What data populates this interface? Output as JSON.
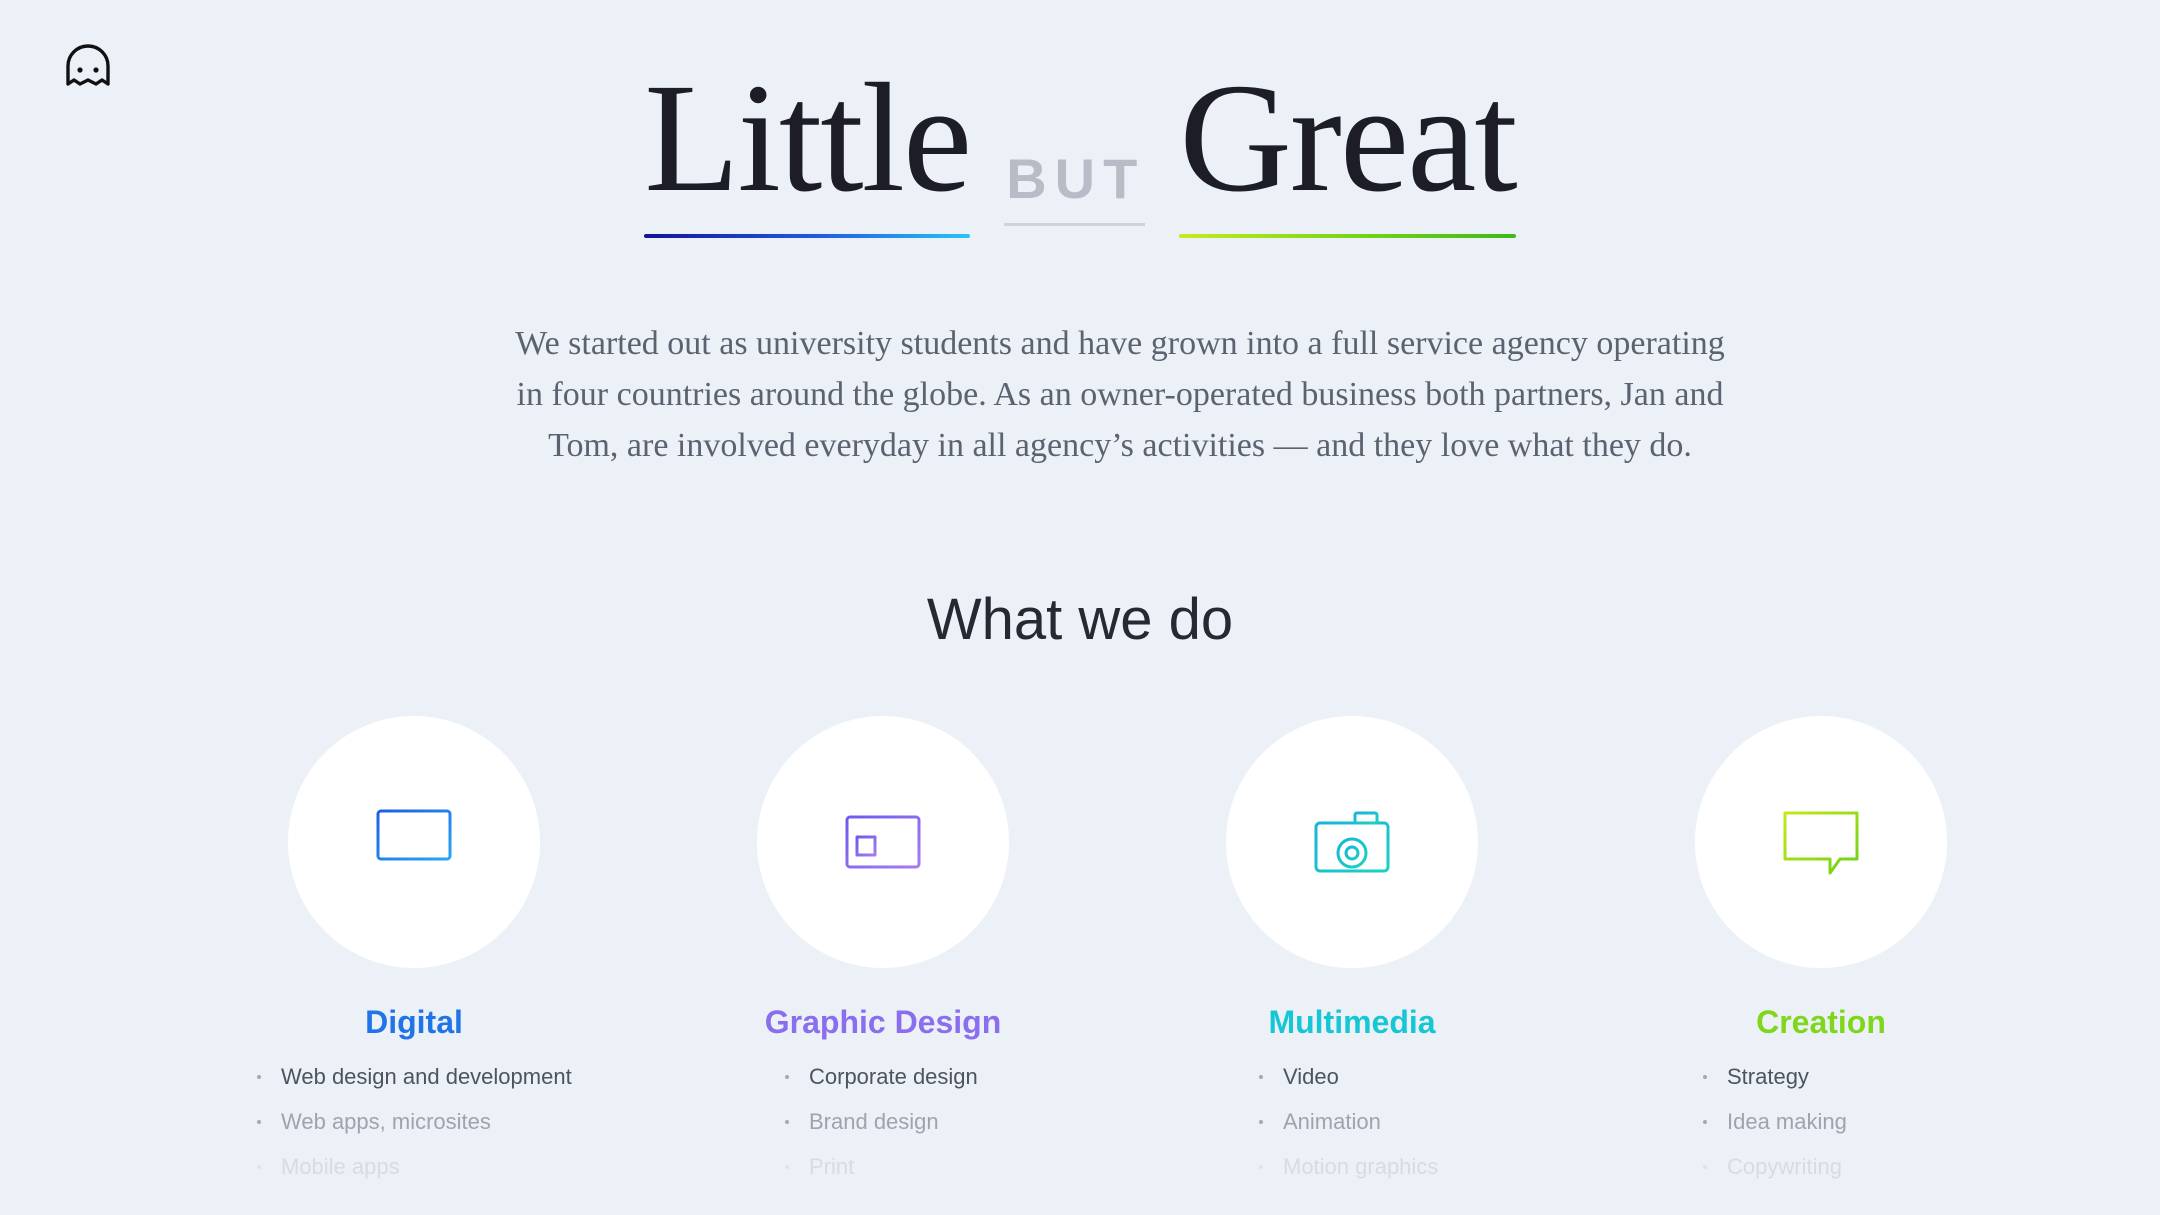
{
  "header": {
    "logo_icon": "ghost-face-icon"
  },
  "hero": {
    "word_left": "Little",
    "word_middle": "BUT",
    "word_right": "Great"
  },
  "intro": {
    "text": "We started out as university students and have grown into a full service agency operating in four countries around the globe. As an owner-operated business both partners, Jan and Tom, are involved everyday in all agency’s activities — and they love what they do."
  },
  "what_we_do": {
    "title": "What we do",
    "services": [
      {
        "title": "Digital",
        "icon": "monitor-icon",
        "color": "#1f74ea",
        "items": [
          "Web design and development",
          "Web apps, microsites",
          "Mobile apps"
        ]
      },
      {
        "title": "Graphic Design",
        "icon": "id-card-icon",
        "color": "#8b6df0",
        "items": [
          "Corporate design",
          "Brand design",
          "Print"
        ]
      },
      {
        "title": "Multimedia",
        "icon": "camera-icon",
        "color": "#16c6d4",
        "items": [
          "Video",
          "Animation",
          "Motion graphics"
        ]
      },
      {
        "title": "Creation",
        "icon": "speech-bubble-icon",
        "color": "#7fd61b",
        "items": [
          "Strategy",
          "Idea making",
          "Copywriting"
        ]
      }
    ]
  }
}
